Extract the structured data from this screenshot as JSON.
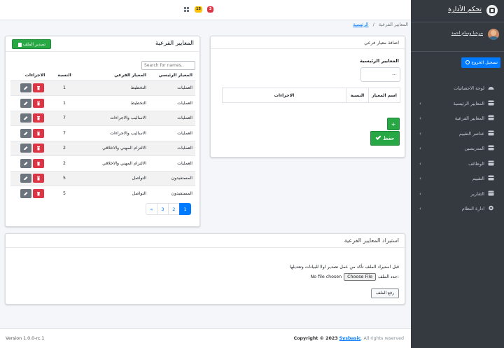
{
  "topbar": {
    "badge_warning": "15",
    "badge_danger": "3"
  },
  "breadcrumb": {
    "home": "الرئيسية",
    "separator": "/",
    "current": "المعايير الفرعية"
  },
  "list_card": {
    "title": "المعايير الفرعية",
    "export_label": "تصدير الملف",
    "search_placeholder": "Search for names..",
    "columns": {
      "main": "المعيار الرئيسي",
      "sub": "المعيار الفرعي",
      "ratio": "النسبة",
      "actions": "الاجراءات"
    },
    "rows": [
      {
        "main": "العمليات",
        "sub": "التخطيط",
        "ratio": "1"
      },
      {
        "main": "العمليات",
        "sub": "التخطيط",
        "ratio": "1"
      },
      {
        "main": "العمليات",
        "sub": "الاساليب والاجراءات",
        "ratio": "7"
      },
      {
        "main": "العمليات",
        "sub": "الاساليب والاجراءات",
        "ratio": "7"
      },
      {
        "main": "العمليات",
        "sub": "الالتزام المهني والاخلاقي",
        "ratio": "2"
      },
      {
        "main": "العمليات",
        "sub": "الالتزام المهني والاخلاقي",
        "ratio": "2"
      },
      {
        "main": "المستفيدون",
        "sub": "التواصل",
        "ratio": "5"
      },
      {
        "main": "المستفيدون",
        "sub": "التواصل",
        "ratio": "5"
      }
    ],
    "pagination": {
      "pages": [
        "1",
        "2",
        "3"
      ],
      "first": "«",
      "current": "1"
    }
  },
  "add_card": {
    "title": "اضافة معيار فرعي",
    "main_label": "المعايير الرئيسية",
    "select_value": "--",
    "columns": {
      "name": "اسم المعيار",
      "ratio": "النسبة",
      "actions": "الاجراءات"
    },
    "plus_label": "+",
    "save_label": "حفظ"
  },
  "import_card": {
    "title": "استيراد المعايير الفرعية",
    "note": "قبل استيراد الملف تأكد من عمل تصدير اولا للبيانات وتعديلها",
    "file_label": "حدد الملف:",
    "choose_file": "Choose File",
    "no_file": "No file chosen",
    "upload_label": "رفع الملف"
  },
  "footer": {
    "version": "Version 1.0.0-rc.1",
    "copyright_prefix": "Copyright © 2023",
    "brand": "Sysbasic",
    "rights": ". All rights reserved"
  },
  "sidebar": {
    "brand": "تحكم الأدارة",
    "user_name": "مرحبا وسام احمد",
    "logout_label": "تسجيل الخروج",
    "items": [
      {
        "label": "لوحة الاحصائيات",
        "icon": "dashboard-icon",
        "has_children": false
      },
      {
        "label": "المعايير الرئيسية",
        "icon": "box-icon",
        "has_children": true
      },
      {
        "label": "المعايير الفرعية",
        "icon": "box-icon",
        "has_children": true
      },
      {
        "label": "عناصر التقييم",
        "icon": "box-icon",
        "has_children": true
      },
      {
        "label": "المدربسين",
        "icon": "box-icon",
        "has_children": true
      },
      {
        "label": "الوظائف",
        "icon": "box-icon",
        "has_children": true
      },
      {
        "label": "التقييم",
        "icon": "box-icon",
        "has_children": true
      },
      {
        "label": "التقارير",
        "icon": "box-icon",
        "has_children": true
      },
      {
        "label": "ادارة النظام",
        "icon": "gear-icon",
        "has_children": true
      }
    ]
  },
  "colors": {
    "primary": "#007bff",
    "success": "#28a745",
    "danger": "#dc3545",
    "secondary": "#6c757d",
    "sidebar": "#343a40",
    "warning": "#ffc107"
  }
}
